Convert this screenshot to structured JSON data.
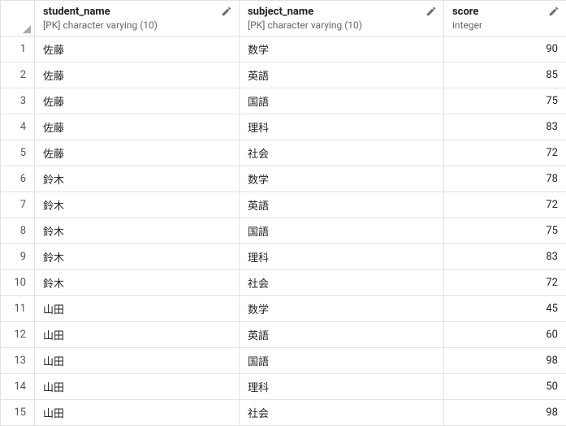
{
  "columns": [
    {
      "name": "student_name",
      "type": "[PK] character varying (10)",
      "align": "left"
    },
    {
      "name": "subject_name",
      "type": "[PK] character varying (10)",
      "align": "left"
    },
    {
      "name": "score",
      "type": "integer",
      "align": "right"
    }
  ],
  "rows": [
    {
      "n": "1",
      "student_name": "佐藤",
      "subject_name": "数学",
      "score": "90"
    },
    {
      "n": "2",
      "student_name": "佐藤",
      "subject_name": "英語",
      "score": "85"
    },
    {
      "n": "3",
      "student_name": "佐藤",
      "subject_name": "国語",
      "score": "75"
    },
    {
      "n": "4",
      "student_name": "佐藤",
      "subject_name": "理科",
      "score": "83"
    },
    {
      "n": "5",
      "student_name": "佐藤",
      "subject_name": "社会",
      "score": "72"
    },
    {
      "n": "6",
      "student_name": "鈴木",
      "subject_name": "数学",
      "score": "78"
    },
    {
      "n": "7",
      "student_name": "鈴木",
      "subject_name": "英語",
      "score": "72"
    },
    {
      "n": "8",
      "student_name": "鈴木",
      "subject_name": "国語",
      "score": "75"
    },
    {
      "n": "9",
      "student_name": "鈴木",
      "subject_name": "理科",
      "score": "83"
    },
    {
      "n": "10",
      "student_name": "鈴木",
      "subject_name": "社会",
      "score": "72"
    },
    {
      "n": "11",
      "student_name": "山田",
      "subject_name": "数学",
      "score": "45"
    },
    {
      "n": "12",
      "student_name": "山田",
      "subject_name": "英語",
      "score": "60"
    },
    {
      "n": "13",
      "student_name": "山田",
      "subject_name": "国語",
      "score": "98"
    },
    {
      "n": "14",
      "student_name": "山田",
      "subject_name": "理科",
      "score": "50"
    },
    {
      "n": "15",
      "student_name": "山田",
      "subject_name": "社会",
      "score": "98"
    }
  ]
}
